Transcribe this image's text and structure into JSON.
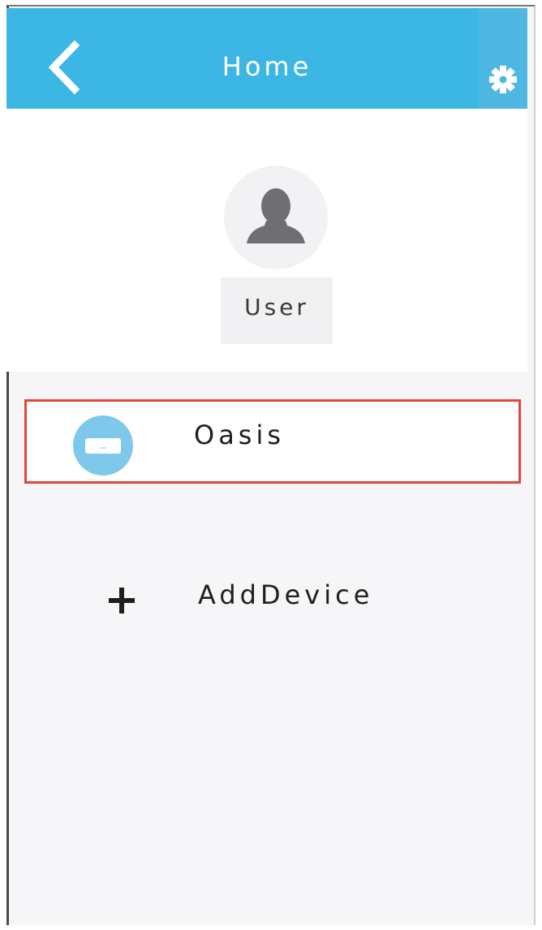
{
  "header": {
    "title": "Home",
    "back_icon": "chevron-left-icon",
    "settings_icon": "gear-icon",
    "background_color": "#3cb6e4"
  },
  "profile": {
    "avatar_icon": "user-silhouette-icon",
    "user_label": "User"
  },
  "devices": [
    {
      "name": "Oasis",
      "icon": "air-conditioner-icon",
      "highlight_color": "#e2473a"
    }
  ],
  "add_device": {
    "icon": "plus-icon",
    "label": "AddDevice"
  }
}
